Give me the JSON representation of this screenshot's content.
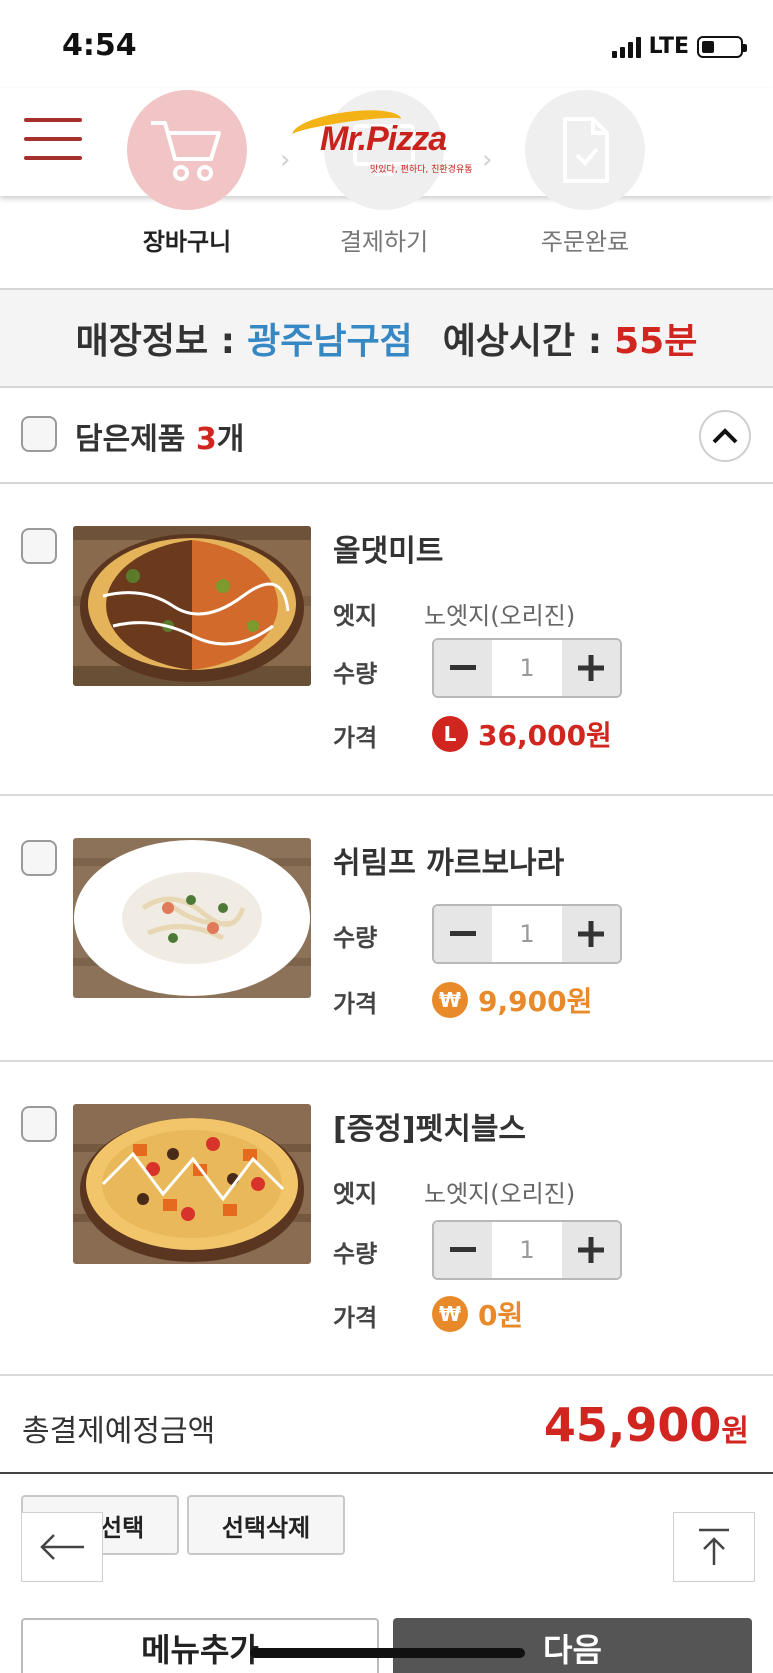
{
  "status_bar": {
    "time": "4:54",
    "network": "LTE"
  },
  "header": {
    "logo_text": "Mr.Pizza",
    "logo_tagline": "맛있다, 편하다, 친환경유통",
    "steps": [
      {
        "label": "장바구니",
        "active": true,
        "icon": "cart-icon"
      },
      {
        "label": "결제하기",
        "active": false,
        "icon": "monitor-icon"
      },
      {
        "label": "주문완료",
        "active": false,
        "icon": "document-icon"
      }
    ]
  },
  "store": {
    "label": "매장정보 :",
    "name": "광주남구점",
    "time_label": "예상시간 :",
    "time_value": "55분"
  },
  "cart": {
    "title": "담은제품",
    "count": "3",
    "count_unit": "개",
    "items": [
      {
        "name": "올댓미트",
        "edge_label": "엣지",
        "edge_value": "노엣지(오리진)",
        "qty_label": "수량",
        "qty": "1",
        "price_label": "가격",
        "size_badge": "L",
        "price": "36,000원",
        "color": "#d1261f"
      },
      {
        "name": "쉬림프 까르보나라",
        "qty_label": "수량",
        "qty": "1",
        "price_label": "가격",
        "size_badge": "₩",
        "price": "9,900원",
        "color": "#e98a2a"
      },
      {
        "name": "[증정]펫치블스",
        "edge_label": "엣지",
        "edge_value": "노엣지(오리진)",
        "qty_label": "수량",
        "qty": "1",
        "price_label": "가격",
        "size_badge": "₩",
        "price": "0원",
        "color": "#e98a2a"
      }
    ]
  },
  "total": {
    "label": "총결제예정금액",
    "amount": "45,900",
    "unit": "원"
  },
  "actions": {
    "select_all": "전체선택",
    "delete_selected": "선택삭제",
    "add_menu": "메뉴추가",
    "next": "다음"
  },
  "colors": {
    "accent_red": "#d1261f",
    "accent_blue": "#3688c4",
    "accent_orange": "#e98a2a",
    "dark_button": "#555555"
  }
}
